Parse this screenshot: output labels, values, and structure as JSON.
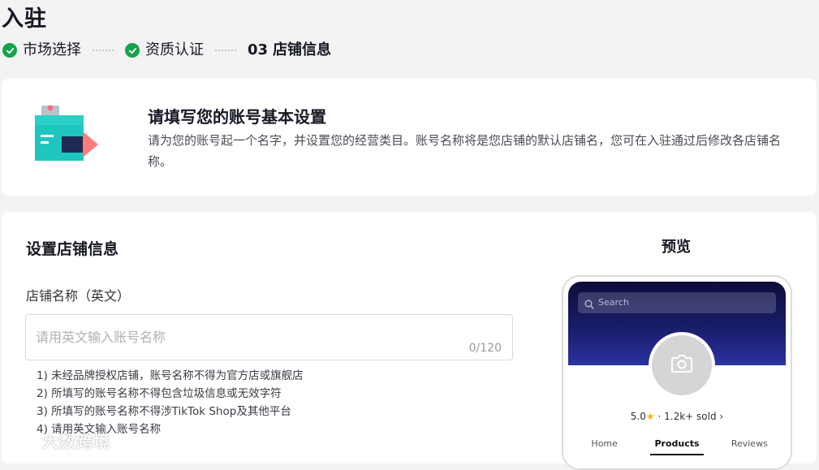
{
  "page": {
    "title": "入驻"
  },
  "steps": [
    {
      "label": "市场选择",
      "state": "done"
    },
    {
      "label": "资质认证",
      "state": "done"
    },
    {
      "num": "03",
      "label": "店铺信息",
      "state": "current"
    }
  ],
  "intro": {
    "title": "请填写您的账号基本设置",
    "description": "请为您的账号起一个名字，并设置您的经营类目。账号名称将是您店铺的默认店铺名，您可在入驻通过后修改各店铺名称。"
  },
  "form": {
    "section_title": "设置店铺信息",
    "store_name": {
      "label": "店铺名称（英文）",
      "placeholder": "请用英文输入账号名称",
      "value": "",
      "counter": "0/120"
    },
    "rules": [
      "1) 未经品牌授权店铺，账号名称不得为官方店或旗舰店",
      "2) 所填写的账号名称不得包含垃圾信息或无效字符",
      "3) 所填写的账号名称不得涉TikTok Shop及其他平台",
      "4) 请用英文输入账号名称"
    ]
  },
  "preview": {
    "title": "预览",
    "search_placeholder": "Search",
    "rating": "5.0",
    "sold": "· 1.2k+ sold",
    "tabs": [
      "Home",
      "Products",
      "Reviews"
    ],
    "active_tab": "Products"
  },
  "watermark": {
    "text": "大数跨境"
  },
  "colors": {
    "success": "#16a34a",
    "banner": "#1a1f6e",
    "star": "#f7b500",
    "illustration_box": "#2bd0c8",
    "illustration_arrow": "#ff6b6b"
  },
  "icons": [
    "check-icon",
    "store-illustration",
    "search-icon",
    "camera-icon",
    "star-icon",
    "chevron-right-icon"
  ]
}
